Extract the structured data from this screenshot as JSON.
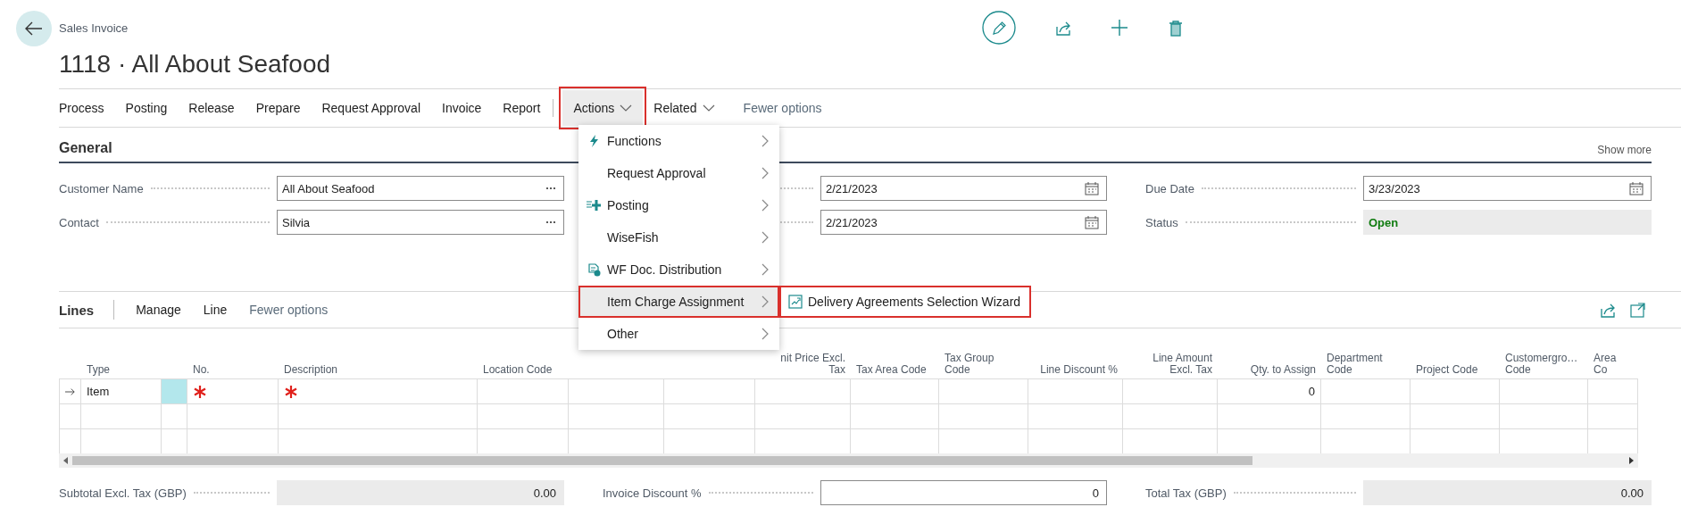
{
  "page": {
    "caption": "Sales Invoice",
    "title": "1118 · All About Seafood"
  },
  "action_bar": [
    {
      "label": "Process",
      "kind": "plain",
      "expanded": false,
      "highlighted": false
    },
    {
      "label": "Posting",
      "kind": "plain",
      "expanded": false,
      "highlighted": false
    },
    {
      "label": "Release",
      "kind": "plain",
      "expanded": false,
      "highlighted": false
    },
    {
      "label": "Prepare",
      "kind": "plain",
      "expanded": false,
      "highlighted": false
    },
    {
      "label": "Request Approval",
      "kind": "plain",
      "expanded": false,
      "highlighted": false
    },
    {
      "label": "Invoice",
      "kind": "plain",
      "expanded": false,
      "highlighted": false
    },
    {
      "label": "Report",
      "kind": "plain",
      "expanded": false,
      "highlighted": false
    },
    {
      "label": "Actions",
      "kind": "dropdown",
      "expanded": true,
      "highlighted": true
    },
    {
      "label": "Related",
      "kind": "dropdown",
      "expanded": false,
      "highlighted": false
    },
    {
      "label": "Fewer options",
      "kind": "muted",
      "expanded": false,
      "highlighted": false
    }
  ],
  "general": {
    "title": "General",
    "show_more": "Show more",
    "columns": [
      [
        {
          "label": "Customer Name",
          "value": "All About Seafood",
          "kind": "lookup"
        },
        {
          "label": "Contact",
          "value": "Silvia",
          "kind": "lookup"
        }
      ],
      [
        {
          "value": "2/21/2023",
          "kind": "date"
        },
        {
          "value": "2/21/2023",
          "kind": "date"
        }
      ],
      [
        {
          "label": "Due Date",
          "value": "3/23/2023",
          "kind": "date"
        },
        {
          "label": "Status",
          "value": "Open",
          "kind": "status"
        }
      ]
    ]
  },
  "lines": {
    "title": "Lines",
    "actions": [
      {
        "label": "Manage",
        "kind": "plain"
      },
      {
        "label": "Line",
        "kind": "plain"
      },
      {
        "label": "Fewer options",
        "kind": "muted"
      }
    ],
    "columns": [
      {
        "label": "Type"
      },
      {
        "label": "No."
      },
      {
        "label": "Description"
      },
      {
        "label": "Location Code"
      },
      {
        "label": "nit Price Excl. Tax"
      },
      {
        "label": "Tax Area Code"
      },
      {
        "label": "Tax Group Code"
      },
      {
        "label": "Line Discount %"
      },
      {
        "label": "Line Amount Excl. Tax"
      },
      {
        "label": "Qty. to Assign"
      },
      {
        "label": "Department Code"
      },
      {
        "label": "Project Code"
      },
      {
        "label": "Customergro… Code"
      },
      {
        "label": "Area Co"
      }
    ],
    "rows": [
      {
        "current": true,
        "type": "Item",
        "no_required": true,
        "description_required": true,
        "qty_to_assign": "0"
      },
      {
        "current": false,
        "no_required": false,
        "description_required": false
      },
      {
        "current": false,
        "no_required": false,
        "description_required": false
      }
    ]
  },
  "menu": [
    {
      "label": "Functions",
      "kind": "bolt",
      "selected": false,
      "highlighted": false
    },
    {
      "label": "Request Approval",
      "kind": "plain",
      "selected": false,
      "highlighted": false
    },
    {
      "label": "Posting",
      "kind": "posting",
      "selected": false,
      "highlighted": false
    },
    {
      "label": "WiseFish",
      "kind": "plain",
      "selected": false,
      "highlighted": false
    },
    {
      "label": "WF Doc. Distribution",
      "kind": "document",
      "selected": false,
      "highlighted": false
    },
    {
      "label": "Item Charge Assignment",
      "kind": "plain",
      "selected": true,
      "highlighted": true
    },
    {
      "label": "Other",
      "kind": "plain",
      "selected": false,
      "highlighted": false
    }
  ],
  "submenu": [
    {
      "label": "Delivery Agreements Selection Wizard",
      "highlighted": true
    }
  ],
  "totals": [
    {
      "label": "Subtotal Excl. Tax (GBP)",
      "value": "0.00",
      "kind": "readonly"
    },
    {
      "label": "Invoice Discount %",
      "value": "0",
      "kind": "input"
    },
    {
      "label": "Total Tax (GBP)",
      "value": "0.00",
      "kind": "readonly"
    }
  ]
}
